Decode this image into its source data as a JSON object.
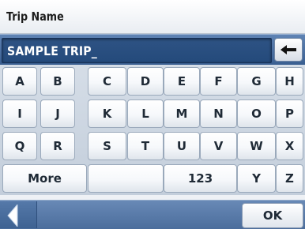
{
  "header": {
    "title": "Trip Name"
  },
  "entry": {
    "value": "SAMPLE TRIP_",
    "backspace_icon": "backspace-arrow-icon"
  },
  "keyboard": {
    "row1": [
      "A",
      "B",
      "C",
      "D",
      "E",
      "F",
      "G",
      "H"
    ],
    "row2": [
      "I",
      "J",
      "K",
      "L",
      "M",
      "N",
      "O",
      "P"
    ],
    "row3": [
      "Q",
      "R",
      "S",
      "T",
      "U",
      "V",
      "W",
      "X"
    ],
    "row4": {
      "more": "More",
      "space": "",
      "numbers": "123",
      "y": "Y",
      "z": "Z"
    }
  },
  "footer": {
    "back_icon": "back-arrow-icon",
    "ok_label": "OK"
  },
  "colors": {
    "accent": "#3a5f91",
    "entry_field": "#244a7b"
  }
}
